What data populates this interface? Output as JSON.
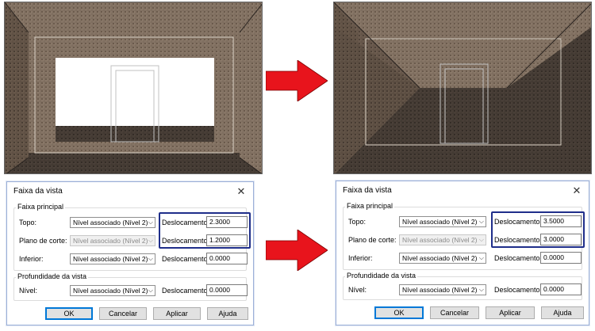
{
  "arrow_color": "#e8141c",
  "dialogs": [
    {
      "title": "Faixa da vista",
      "close_glyph": "✕",
      "primary_range": {
        "heading": "Faixa principal",
        "top": {
          "label": "Topo:",
          "value": "Nível associado (Nível 2)",
          "offset_label": "Deslocamento:",
          "offset": "2.3000"
        },
        "cut_plane": {
          "label": "Plano de corte:",
          "value": "Nível associado (Nível 2)",
          "offset_label": "Deslocamento:",
          "offset": "1.2000"
        },
        "bottom": {
          "label": "Inferior:",
          "value": "Nível associado (Nível 2)",
          "offset_label": "Deslocamento:",
          "offset": "0.0000"
        }
      },
      "view_depth": {
        "heading": "Profundidade da vista",
        "level": {
          "label": "Nível:",
          "value": "Nível associado (Nível 2)",
          "offset_label": "Deslocamento:",
          "offset": "0.0000"
        }
      },
      "buttons": {
        "ok": "OK",
        "cancel": "Cancelar",
        "apply": "Aplicar",
        "help": "Ajuda"
      }
    },
    {
      "title": "Faixa da vista",
      "close_glyph": "✕",
      "primary_range": {
        "heading": "Faixa principal",
        "top": {
          "label": "Topo:",
          "value": "Nível associado (Nível 2)",
          "offset_label": "Deslocamento:",
          "offset": "3.5000"
        },
        "cut_plane": {
          "label": "Plano de corte:",
          "value": "Nível associado (Nível 2)",
          "offset_label": "Deslocamento:",
          "offset": "3.0000"
        },
        "bottom": {
          "label": "Inferior:",
          "value": "Nível associado (Nível 2)",
          "offset_label": "Deslocamento:",
          "offset": "0.0000"
        }
      },
      "view_depth": {
        "heading": "Profundidade da vista",
        "level": {
          "label": "Nível:",
          "value": "Nível associado (Nível 2)",
          "offset_label": "Deslocamento:",
          "offset": "0.0000"
        }
      },
      "buttons": {
        "ok": "OK",
        "cancel": "Cancelar",
        "apply": "Aplicar",
        "help": "Ajuda"
      }
    }
  ]
}
